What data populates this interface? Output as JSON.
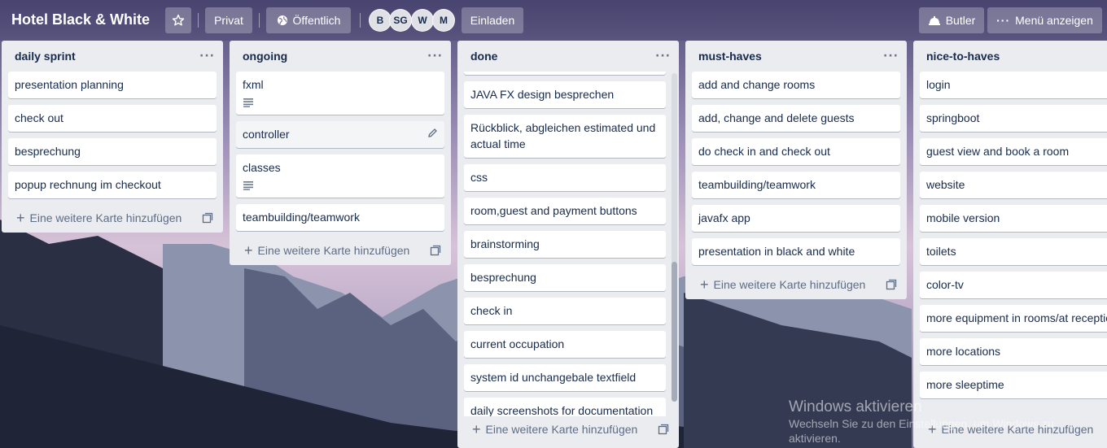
{
  "board": {
    "title": "Hotel Black & White",
    "visibility_private": "Privat",
    "visibility_public": "Öffentlich",
    "invite_label": "Einladen",
    "butler_label": "Butler",
    "menu_label": "Menü anzeigen",
    "members": [
      "B",
      "SG",
      "W",
      "M"
    ]
  },
  "add_card_label": "Eine weitere Karte hinzufügen",
  "lists": [
    {
      "title": "daily sprint",
      "cards": [
        "presentation planning",
        "check out",
        "besprechung",
        "popup rechnung im checkout"
      ]
    },
    {
      "title": "ongoing",
      "cards": [
        "fxml",
        "controller",
        "classes",
        "teambuilding/teamwork"
      ]
    },
    {
      "title": "done",
      "cards": [
        "JAVA FX design besprechen",
        "Rückblick, abgleichen estimated und actual time",
        "css",
        "room,guest and payment buttons",
        "brainstorming",
        "besprechung",
        "check in",
        "current occupation",
        "system id unchangebale textfield",
        "daily screenshots for documentation"
      ]
    },
    {
      "title": "must-haves",
      "cards": [
        "add and change rooms",
        "add, change and delete guests",
        "do check in and check out",
        "teambuilding/teamwork",
        "javafx app",
        "presentation in black and white"
      ]
    },
    {
      "title": "nice-to-haves",
      "cards": [
        "login",
        "springboot",
        "guest view and book a room",
        "website",
        "mobile version",
        "toilets",
        "color-tv",
        "more equipment in rooms/at reception",
        "more locations",
        "more sleeptime"
      ]
    }
  ],
  "watermark": {
    "title": "Windows aktivieren",
    "subtitle": "Wechseln Sie zu den Einstellungen, um Windows zu aktivieren."
  },
  "colors": {
    "list_bg": "#ebecf0",
    "card_bg": "#ffffff",
    "text": "#172b4d",
    "muted": "#5e6c84"
  }
}
